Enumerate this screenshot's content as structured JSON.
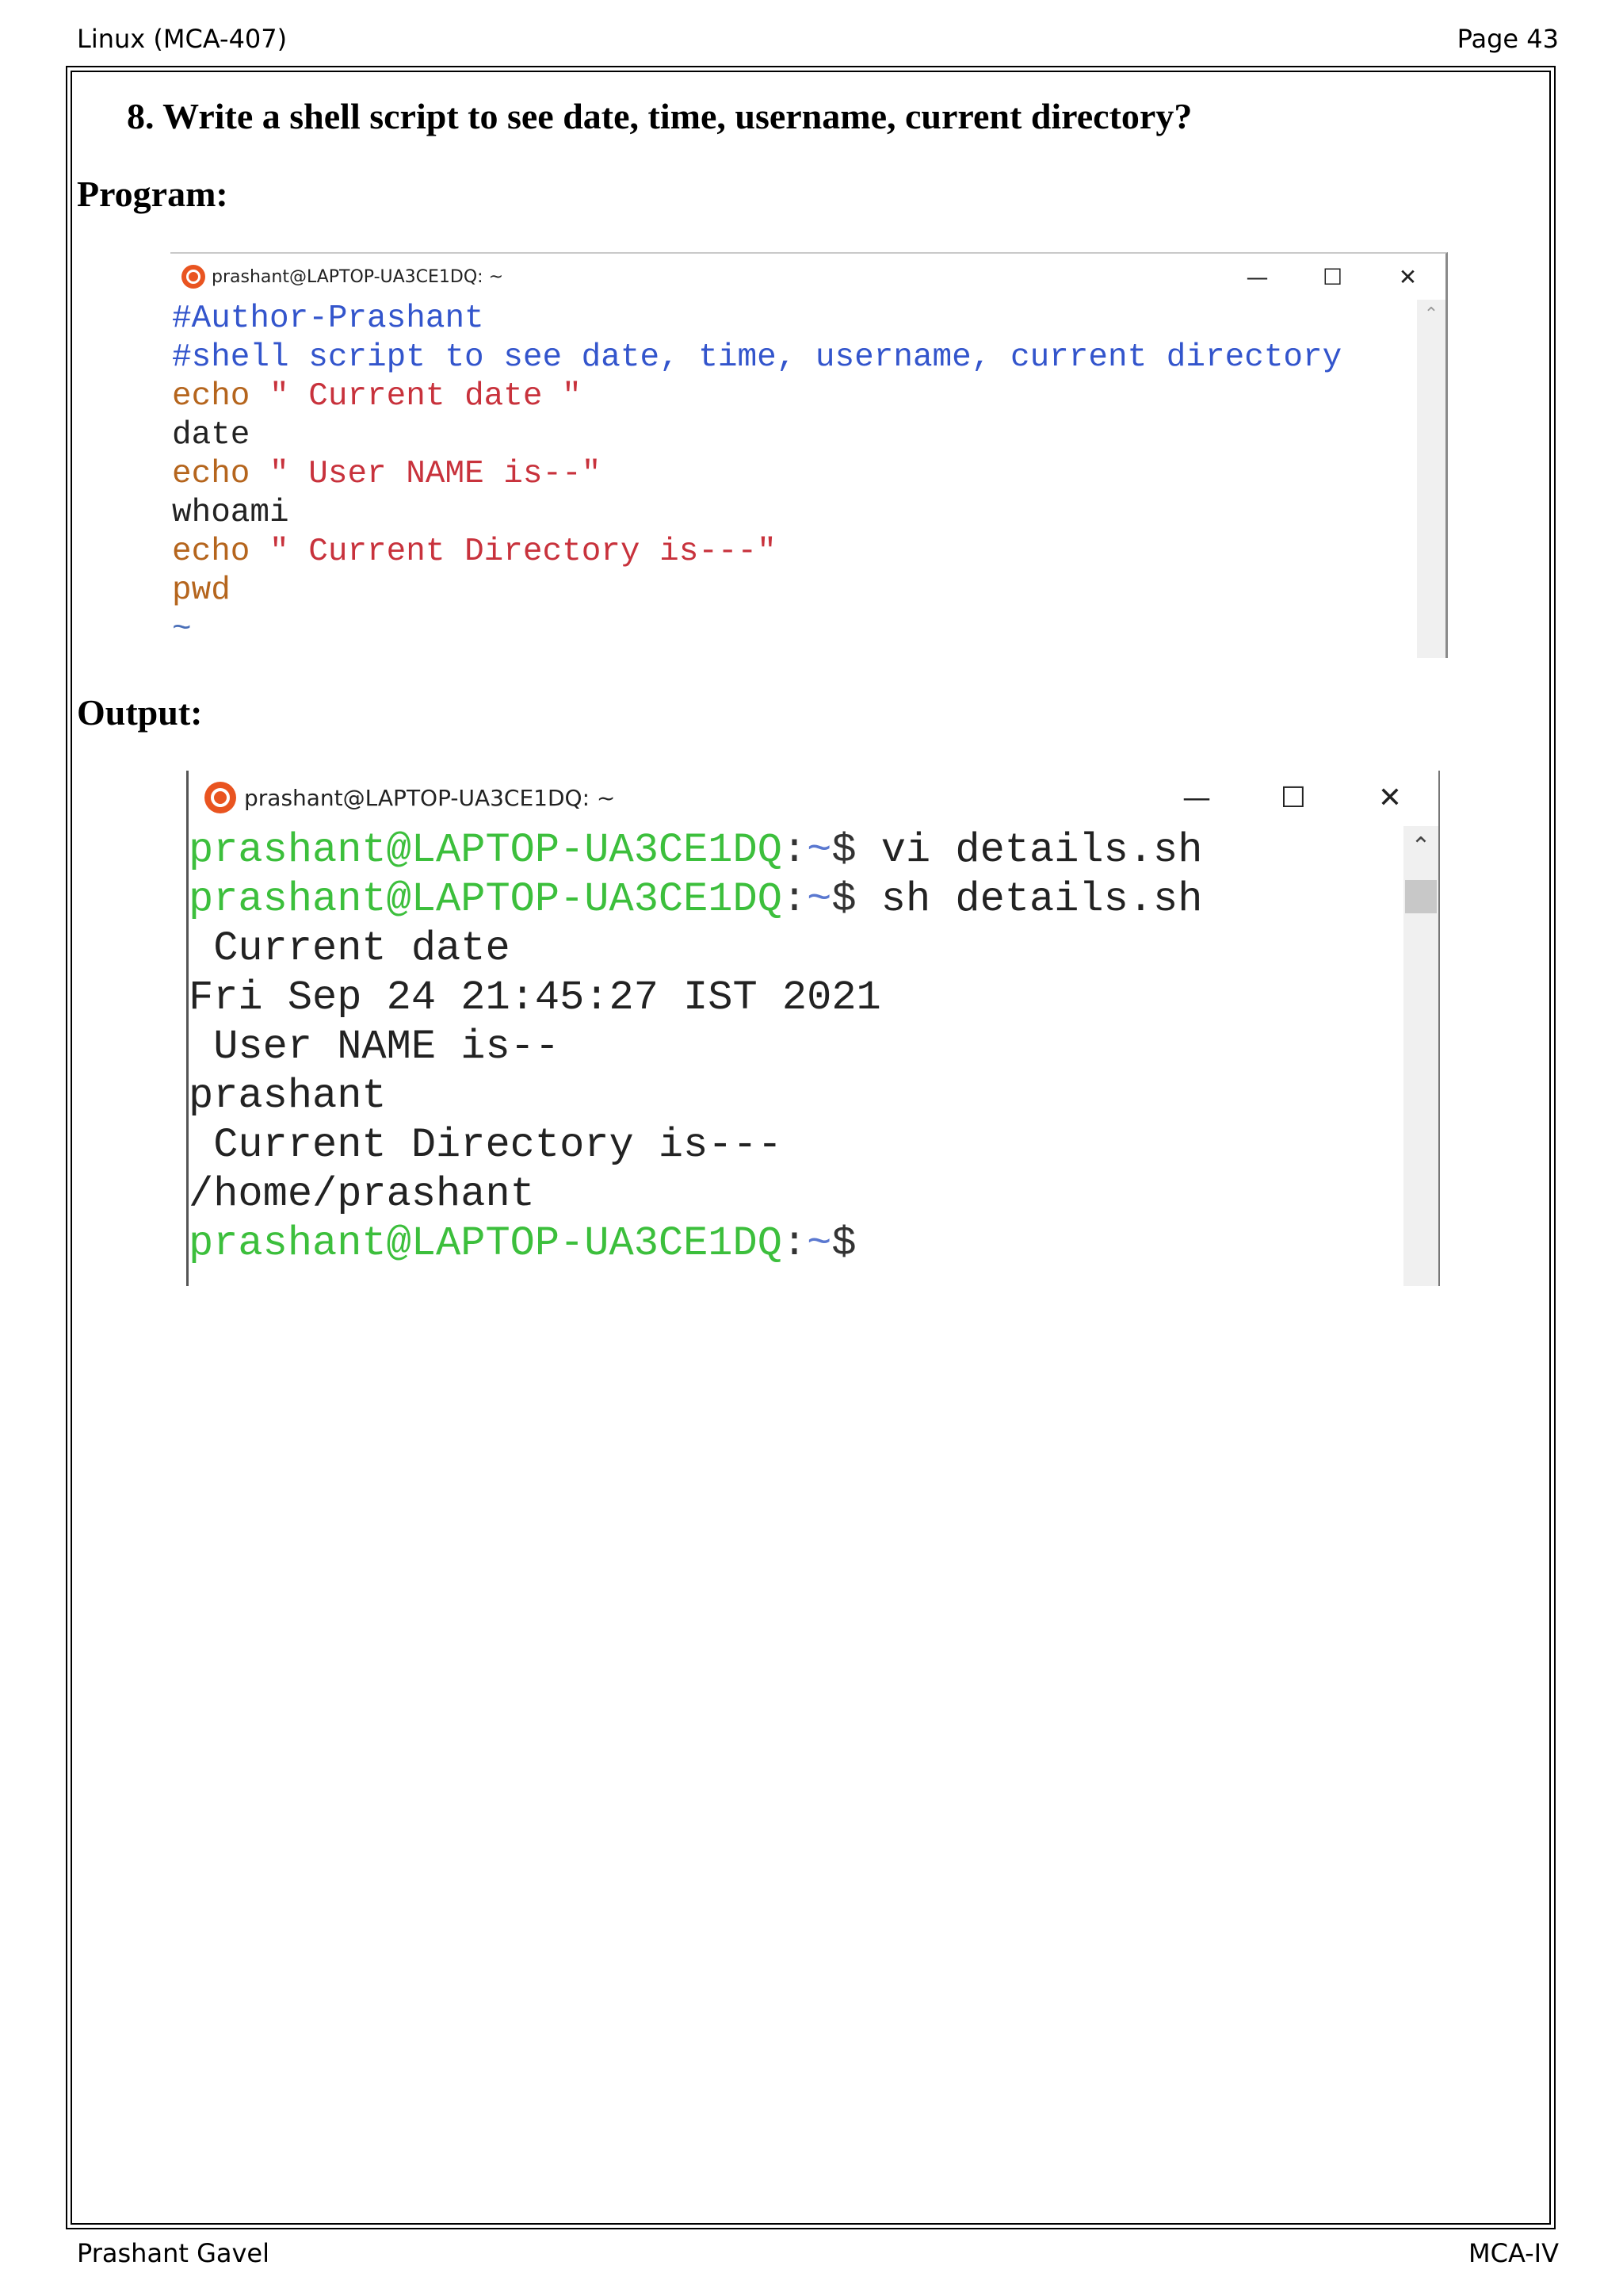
{
  "header": {
    "left": "Linux (MCA-407)",
    "right": "Page 43"
  },
  "footer": {
    "left": "Prashant Gavel",
    "right": "MCA-IV"
  },
  "question": "8.  Write a shell script to see date, time, username, current directory?",
  "program_heading": "Program:",
  "output_heading": "Output:",
  "editor_window": {
    "title": "prashant@LAPTOP-UA3CE1DQ: ~",
    "controls": {
      "minimize": "—",
      "maximize": "☐",
      "close": "✕"
    },
    "lines": {
      "l1": "#Author-Prashant",
      "l2": "#shell script to see date, time, username, current directory",
      "l3_kw": "echo",
      "l3_str": " \" Current date \"",
      "l4": "date",
      "l5_kw": "echo",
      "l5_str": " \" User NAME is--\"",
      "l6": "whoami",
      "l7_kw": "echo",
      "l7_str": " \" Current Directory is---\"",
      "l8": "pwd",
      "l9": "~"
    }
  },
  "terminal_window": {
    "title": "prashant@LAPTOP-UA3CE1DQ: ~",
    "controls": {
      "minimize": "—",
      "maximize": "☐",
      "close": "✕"
    },
    "prompt": {
      "user": "prashant@LAPTOP-UA3CE1DQ",
      "colon": ":",
      "tilde": "~",
      "dollar": "$"
    },
    "cmd1": " vi details.sh",
    "cmd2": " sh details.sh",
    "out1": " Current date",
    "out2": "Fri Sep 24 21:45:27 IST 2021",
    "out3": " User NAME is--",
    "out4": "prashant",
    "out5": " Current Directory is---",
    "out6": "/home/prashant"
  },
  "icons": {
    "window_icon": "ubuntu-icon",
    "scroll_up": "chevron-up-icon"
  }
}
